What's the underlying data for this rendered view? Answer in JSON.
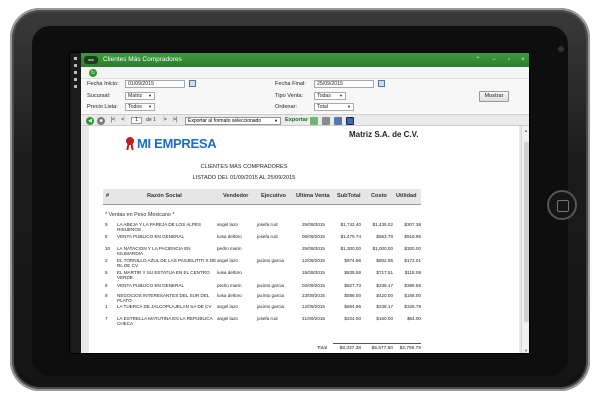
{
  "window": {
    "title": "Clientes Más Compradores",
    "app_badge": "ww"
  },
  "filters": {
    "fecha_inicio_label": "Fecha Inicio:",
    "fecha_inicio_value": "01/09/2015",
    "fecha_final_label": "Fecha Final:",
    "fecha_final_value": "25/09/2015",
    "sucursal_label": "Sucursal:",
    "sucursal_value": "Matriz",
    "tipo_venta_label": "Tipo Venta:",
    "tipo_venta_value": "Todas",
    "precio_lista_label": "Precio Lista:",
    "precio_lista_value": "Todos",
    "ordenar_label": "Ordenar:",
    "ordenar_value": "Total",
    "mostrar_button": "Mostrar"
  },
  "report_toolbar": {
    "page_value": "1",
    "page_of": "de 1",
    "export_select": "Exportar al formato seleccionado",
    "export_link": "Exportar"
  },
  "report": {
    "logo_text": "MI EMPRESA",
    "company": "Matriz S.A. de C.V.",
    "title": "CLIENTES MÁS COMPRADORES",
    "subtitle": "LISTADO DEL 01/09/2015 AL 25/09/2015",
    "columns": [
      "#",
      "Razón Social",
      "Vendedor",
      "Ejecutivo",
      "Ultima Venta",
      "SubTotal",
      "Costo",
      "Utilidad"
    ],
    "section_label": "* Ventas en Peso Mexicano *",
    "rows": [
      {
        "id": "9",
        "razon": "LA ABEJA Y LA PAREJA DE LOS ALPES RISUENOS",
        "vendedor": "angel lazo",
        "ejecutivo": "josefa ruiz",
        "ultima": "25/09/2015",
        "subtotal": "$1,742.40",
        "costo": "$1,435.02",
        "utilidad": "$307.38"
      },
      {
        "id": "8",
        "razon": "VENTA PUBLICO EN GENERAL",
        "vendedor": "luisa deltoro",
        "ejecutivo": "josefa ruiz",
        "ultima": "08/09/2015",
        "subtotal": "$1,479.74",
        "costo": "$563.78",
        "utilidad": "$915.96"
      },
      {
        "id": "10",
        "razon": "LA NATACION Y LA PACIENCIA EN KILIMARDIA",
        "vendedor": "pedro marin",
        "ejecutivo": "",
        "ultima": "25/09/2015",
        "subtotal": "$1,300.00",
        "costo": "$1,000.00",
        "utilidad": "$300.00"
      },
      {
        "id": "2",
        "razon": "EL TORNILLO AZUL DE LAS PASJELITITI S DE RL DE CV",
        "vendedor": "angel lazo",
        "ejecutivo": "jacinto garcia",
        "ultima": "12/09/2015",
        "subtotal": "$974.96",
        "costo": "$802.95",
        "utilidad": "$172.01"
      },
      {
        "id": "5",
        "razon": "EL MARTIR Y SU ESTATUA EN EL CENTRO VERDE",
        "vendedor": "luisa deltoro",
        "ejecutivo": "",
        "ultima": "15/09/2015",
        "subtotal": "$835.59",
        "costo": "$717.51",
        "utilidad": "$118.08"
      },
      {
        "id": "6",
        "razon": "VENTA PUBLICO EN GENERAL",
        "vendedor": "pedro marin",
        "ejecutivo": "jacinto garcia",
        "ultima": "02/09/2015",
        "subtotal": "$627.73",
        "costo": "$239.17",
        "utilidad": "$388.56"
      },
      {
        "id": "8",
        "razon": "NEGOCIOS INTERESANTES DEL SUR DEL PLATO",
        "vendedor": "luisa deltoro",
        "ejecutivo": "jacinto garcia",
        "ultima": "23/09/2015",
        "subtotal": "$588.00",
        "costo": "$420.00",
        "utilidad": "$168.00"
      },
      {
        "id": "1",
        "razon": "LA TUERCA DE JALCOPLAJELAN SA DE CV",
        "vendedor": "angel lazo",
        "ejecutivo": "jacinto garcia",
        "ultima": "12/09/2015",
        "subtotal": "$564.96",
        "costo": "$239.17",
        "utilidad": "$325.79"
      },
      {
        "id": "7",
        "razon": "LA ESTRELLA MATUTINA EN LA REPUBLICA CHECA",
        "vendedor": "angel lazo",
        "ejecutivo": "josefa ruiz",
        "ultima": "21/09/2015",
        "subtotal": "$224.00",
        "costo": "$160.00",
        "utilidad": "$64.00"
      }
    ],
    "total_label": "Total",
    "total_subtotal": "$8,337.38",
    "total_costo": "$5,577.60",
    "total_utilidad": "$2,759.78"
  }
}
